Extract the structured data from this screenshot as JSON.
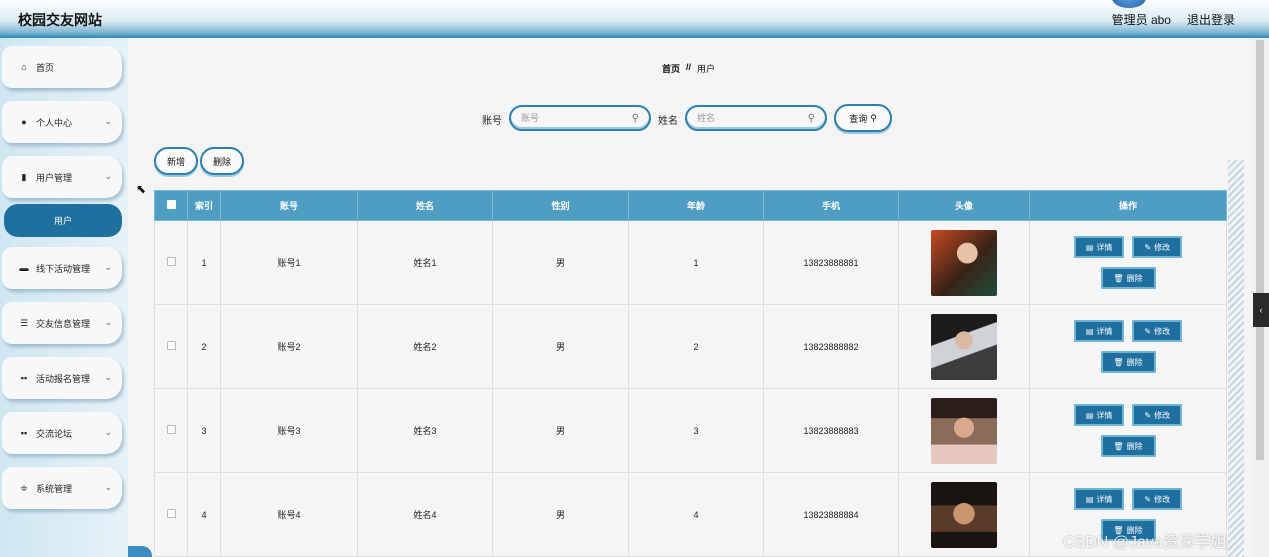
{
  "header": {
    "site_title": "校园交友网站",
    "user_label": "管理员 abo",
    "logout_label": "退出登录"
  },
  "sidebar": {
    "items": [
      {
        "label": "首页",
        "icon": "home-icon",
        "has_chevron": false
      },
      {
        "label": "个人中心",
        "icon": "user-icon",
        "has_chevron": true
      },
      {
        "label": "用户管理",
        "icon": "clipboard-icon",
        "has_chevron": true
      },
      {
        "label": "线下活动管理",
        "icon": "briefcase-icon",
        "has_chevron": true
      },
      {
        "label": "交友信息管理",
        "icon": "list-icon",
        "has_chevron": true
      },
      {
        "label": "活动报名管理",
        "icon": "grid-icon",
        "has_chevron": true
      },
      {
        "label": "交流论坛",
        "icon": "grid-icon",
        "has_chevron": true
      },
      {
        "label": "系统管理",
        "icon": "sliders-icon",
        "has_chevron": true
      }
    ],
    "active_sub_item": "用户"
  },
  "breadcrumb": {
    "home": "首页",
    "separator": "//",
    "current": "用户"
  },
  "search": {
    "account_label": "账号",
    "account_placeholder": "账号",
    "name_label": "姓名",
    "name_placeholder": "姓名",
    "query_label": "查询"
  },
  "actions": {
    "add_label": "新增",
    "delete_label": "删除"
  },
  "table": {
    "headers": [
      "索引",
      "账号",
      "姓名",
      "性别",
      "年龄",
      "手机",
      "头像",
      "操作"
    ],
    "rows": [
      {
        "index": "1",
        "account": "账号1",
        "name": "姓名1",
        "gender": "男",
        "age": "1",
        "phone": "13823888881"
      },
      {
        "index": "2",
        "account": "账号2",
        "name": "姓名2",
        "gender": "男",
        "age": "2",
        "phone": "13823888882"
      },
      {
        "index": "3",
        "account": "账号3",
        "name": "姓名3",
        "gender": "男",
        "age": "3",
        "phone": "13823888883"
      },
      {
        "index": "4",
        "account": "账号4",
        "name": "姓名4",
        "gender": "男",
        "age": "4",
        "phone": "13823888884"
      }
    ],
    "row_actions": {
      "detail": "详情",
      "edit": "修改",
      "delete": "删除"
    }
  },
  "watermark": "CSDN @Java资深学姐",
  "colors": {
    "accent": "#1f6f9f",
    "table_header": "#4f9dc3",
    "border_accent": "#2c80b0"
  }
}
